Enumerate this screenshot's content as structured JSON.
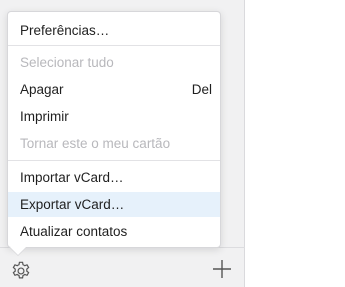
{
  "menu": {
    "items": [
      {
        "label": "Preferências…",
        "shortcut": ""
      },
      {
        "label": "Selecionar tudo",
        "shortcut": ""
      },
      {
        "label": "Apagar",
        "shortcut": "Del"
      },
      {
        "label": "Imprimir",
        "shortcut": ""
      },
      {
        "label": "Tornar este o meu cartão",
        "shortcut": ""
      },
      {
        "label": "Importar vCard…",
        "shortcut": ""
      },
      {
        "label": "Exportar vCard…",
        "shortcut": ""
      },
      {
        "label": "Atualizar contatos",
        "shortcut": ""
      }
    ]
  },
  "toolbar": {
    "settings_icon": "gear-icon",
    "add_icon": "plus-icon"
  },
  "colors": {
    "highlight": "#e6f1fb",
    "disabled_text": "#b8b8bc",
    "sidebar_bg": "#f1f1f2"
  }
}
